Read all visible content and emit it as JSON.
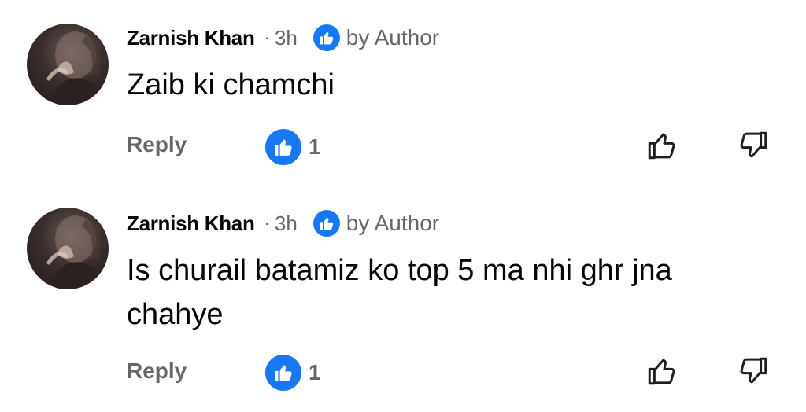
{
  "comments": [
    {
      "author": "Zarnish Khan",
      "separator": "·",
      "time": "3h",
      "liked_by": "by Author",
      "text": "Zaib ki chamchi",
      "reply_label": "Reply",
      "reaction_count": "1"
    },
    {
      "author": "Zarnish Khan",
      "separator": "·",
      "time": "3h",
      "liked_by": "by Author",
      "text": "Is churail batamiz ko top 5 ma nhi ghr jna chahye",
      "reply_label": "Reply",
      "reaction_count": "1"
    }
  ],
  "icons": {
    "like_badge": "thumbs-up-icon",
    "upvote": "thumbs-up-outline-icon",
    "downvote": "thumbs-down-outline-icon"
  },
  "colors": {
    "accent": "#1877f2",
    "secondary_text": "#65676b",
    "primary_text": "#050505"
  }
}
